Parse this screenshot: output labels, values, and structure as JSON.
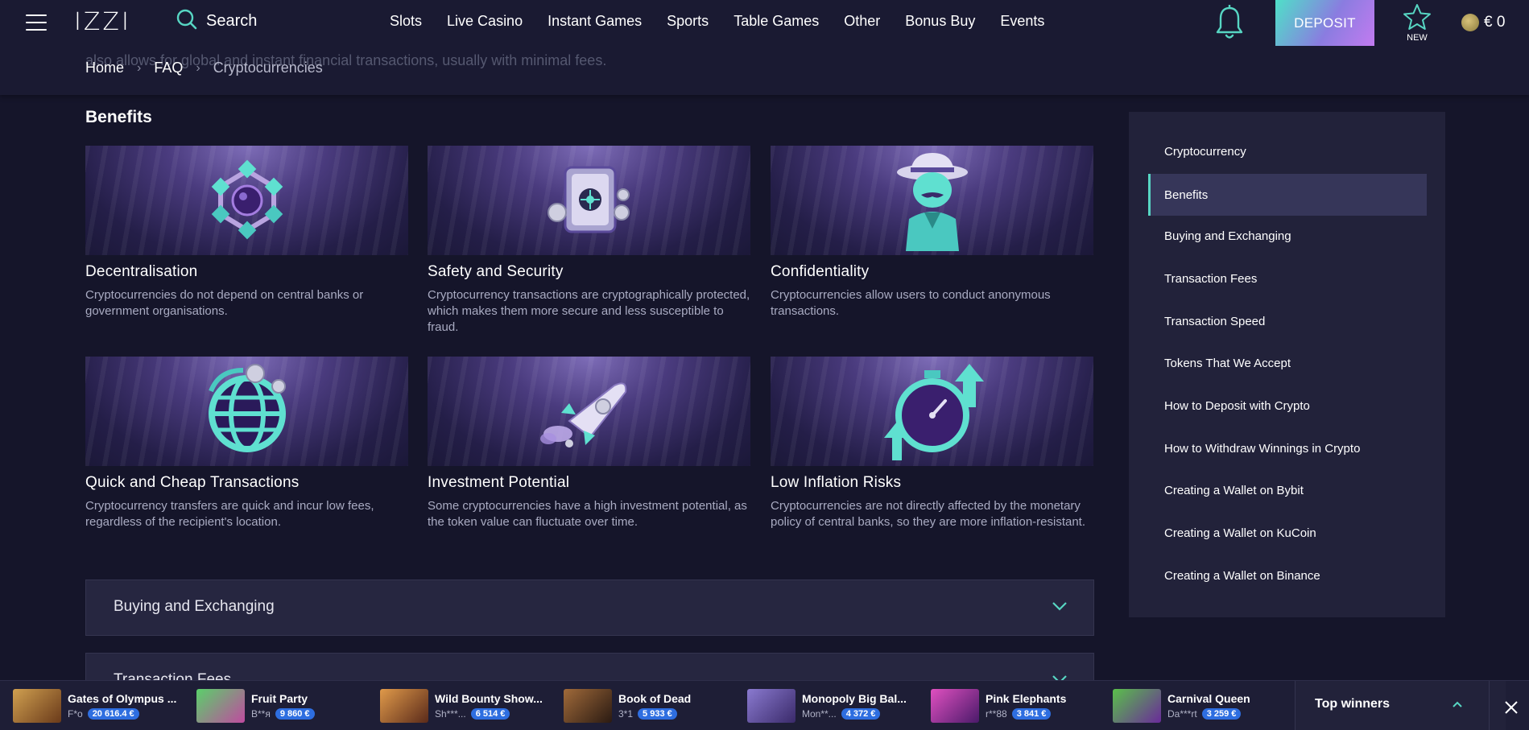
{
  "header": {
    "logo": "IZZI",
    "search_label": "Search",
    "nav": [
      "Slots",
      "Live Casino",
      "Instant Games",
      "Sports",
      "Table Games",
      "Other",
      "Bonus Buy",
      "Events"
    ],
    "deposit_label": "DEPOSIT",
    "new_label": "NEW",
    "balance": "€ 0",
    "accent_color": "#57d6c3"
  },
  "faded_text": "also allows for global and instant financial transactions, usually with minimal fees.",
  "breadcrumb": [
    "Home",
    "FAQ",
    "Cryptocurrencies"
  ],
  "benefits": {
    "title": "Benefits",
    "cards": [
      {
        "title": "Decentralisation",
        "desc": "Cryptocurrencies do not depend on central banks or government organisations.",
        "icon": "network-cubes-icon"
      },
      {
        "title": "Safety and Security",
        "desc": "Cryptocurrency transactions are cryptographically protected, which makes them more secure and less susceptible to fraud.",
        "icon": "safe-icon"
      },
      {
        "title": "Confidentiality",
        "desc": "Cryptocurrencies allow users to conduct anonymous transactions.",
        "icon": "spy-icon"
      },
      {
        "title": "Quick and Cheap Transactions",
        "desc": "Cryptocurrency transfers are quick and incur low fees, regardless of the recipient's location.",
        "icon": "globe-icon"
      },
      {
        "title": "Investment Potential",
        "desc": "Some cryptocurrencies have a high investment potential, as the token value can fluctuate over time.",
        "icon": "rocket-icon"
      },
      {
        "title": "Low Inflation Risks",
        "desc": "Cryptocurrencies are not directly affected by the monetary policy of central banks, so they are more inflation-resistant.",
        "icon": "stopwatch-icon"
      }
    ]
  },
  "accordions": [
    "Buying and Exchanging",
    "Transaction Fees"
  ],
  "sidebar": {
    "items": [
      "Cryptocurrency",
      "Benefits",
      "Buying and Exchanging",
      "Transaction Fees",
      "Transaction Speed",
      "Tokens That We Accept",
      "How to Deposit with Crypto",
      "How to Withdraw Winnings in Crypto",
      "Creating a Wallet on Bybit",
      "Creating a Wallet on KuCoin",
      "Creating a Wallet on Binance"
    ],
    "active": "Benefits"
  },
  "bottom_bar": {
    "winners": [
      {
        "game": "Gates of Olympus ...",
        "user": "F*o",
        "amount": "20 616.4 €",
        "color": "#b07a3a"
      },
      {
        "game": "Fruit Party",
        "user": "B**я",
        "amount": "9 860 €",
        "color": "#3fa24a"
      },
      {
        "game": "Wild Bounty Show...",
        "user": "Sh***...",
        "amount": "6 514 €",
        "color": "#a05a2a"
      },
      {
        "game": "Book of Dead",
        "user": "3*1",
        "amount": "5 933 €",
        "color": "#7a4a2a"
      },
      {
        "game": "Monopoly Big Bal...",
        "user": "Mon**...",
        "amount": "4 372 €",
        "color": "#5a4aa0"
      },
      {
        "game": "Pink Elephants",
        "user": "r**88",
        "amount": "3 841 €",
        "color": "#c03a9a"
      },
      {
        "game": "Carnival Queen",
        "user": "Da***rt",
        "amount": "3 259 €",
        "color": "#6a3a9a"
      }
    ],
    "top_winners_label": "Top winners"
  }
}
